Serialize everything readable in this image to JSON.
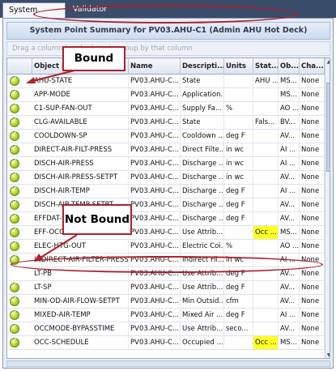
{
  "tabs": [
    {
      "label": "System Summary",
      "active": true
    },
    {
      "label": "Validator",
      "active": false
    }
  ],
  "panel": {
    "title": "System Point Summary for PV03.AHU-C1 (Admin AHU Hot Deck)",
    "group_hint": "Drag a column header here to group by that column"
  },
  "columns": [
    "",
    "Object N",
    "Name",
    "Descripti...",
    "Units",
    "Stat...",
    "Ob...",
    "Cha..."
  ],
  "rows": [
    {
      "object_name": "AHU-STATE",
      "name": "PV03.AHU-C...",
      "description": "State",
      "units": "",
      "status": "AHU ...",
      "object": "MS...",
      "change": "None",
      "status_highlight": false
    },
    {
      "object_name": "APP-MODE",
      "name": "PV03.AHU-C...",
      "description": "Application...",
      "units": "",
      "status": "",
      "object": "MS...",
      "change": "None",
      "status_highlight": false
    },
    {
      "object_name": "C1-SUP-FAN-OUT",
      "name": "PV03.AHU-C...",
      "description": "Supply Fa...",
      "units": "%",
      "status": "",
      "object": "AO ...",
      "change": "None",
      "status_highlight": false
    },
    {
      "object_name": "CLG-AVAILABLE",
      "name": "PV03.AHU-C...",
      "description": "State",
      "units": "",
      "status": "Fals...",
      "object": "BV...",
      "change": "None",
      "status_highlight": false
    },
    {
      "object_name": "COOLDOWN-SP",
      "name": "PV03.AHU-C...",
      "description": "Cooldown ...",
      "units": "deg F",
      "status": "",
      "object": "AV...",
      "change": "None",
      "status_highlight": false
    },
    {
      "object_name": "DIRECT-AIR-FILT-PRESS",
      "name": "PV03.AHU-C...",
      "description": "Direct Filte...",
      "units": "in wc",
      "status": "",
      "object": "AI ...",
      "change": "None",
      "status_highlight": false
    },
    {
      "object_name": "DISCH-AIR-PRESS",
      "name": "PV03.AHU-C...",
      "description": "Discharge ...",
      "units": "in wc",
      "status": "",
      "object": "AI ...",
      "change": "None",
      "status_highlight": false
    },
    {
      "object_name": "DISCH-AIR-PRESS-SETPT",
      "name": "PV03.AHU-C...",
      "description": "Discharge ...",
      "units": "in wc",
      "status": "",
      "object": "AV...",
      "change": "None",
      "status_highlight": false
    },
    {
      "object_name": "DISCH-AIR-TEMP",
      "name": "PV03.AHU-C...",
      "description": "Discharge ...",
      "units": "deg F",
      "status": "",
      "object": "AI ...",
      "change": "None",
      "status_highlight": false
    },
    {
      "object_name": "DISCH-AIR-TEMP-SETPT",
      "name": "PV03.AHU-C...",
      "description": "Discharge ...",
      "units": "deg F",
      "status": "",
      "object": "AV...",
      "change": "None",
      "status_highlight": false
    },
    {
      "object_name": "EFFDAT-SP",
      "name": "PV03.AHU-C...",
      "description": "Discharge ...",
      "units": "deg F",
      "status": "",
      "object": "AV...",
      "change": "None",
      "status_highlight": false
    },
    {
      "object_name": "EFF-OCC",
      "name": "PV03.AHU-C...",
      "description": "Use Attrib...",
      "units": "",
      "status": "Occ ...",
      "object": "MS...",
      "change": "None",
      "status_highlight": true
    },
    {
      "object_name": "ELEC-HTG-OUT",
      "name": "PV03.AHU-C...",
      "description": "Electric Coi...",
      "units": "%",
      "status": "",
      "object": "AO ...",
      "change": "None",
      "status_highlight": false
    },
    {
      "object_name": "INDIRECT-AIR-FILTER-PRESS",
      "name": "PV03.AHU-C...",
      "description": "Indirect Fil...",
      "units": "in wc",
      "status": "",
      "object": "AI ...",
      "change": "None",
      "status_highlight": false
    },
    {
      "object_name": "LT-PB",
      "name": "PV03.AHU-C...",
      "description": "Use Attrib...",
      "units": "deg F",
      "status": "",
      "object": "AV...",
      "change": "None",
      "status_highlight": false,
      "unbound": true
    },
    {
      "object_name": "LT-SP",
      "name": "PV03.AHU-C...",
      "description": "Use Attrib...",
      "units": "deg F",
      "status": "",
      "object": "AV...",
      "change": "None",
      "status_highlight": false
    },
    {
      "object_name": "MIN-OD-AIR-FLOW-SETPT",
      "name": "PV03.AHU-C...",
      "description": "Min Outsid...",
      "units": "cfm",
      "status": "",
      "object": "AV...",
      "change": "None",
      "status_highlight": false
    },
    {
      "object_name": "MIXED-AIR-TEMP",
      "name": "PV03.AHU-C...",
      "description": "Mixed Air ...",
      "units": "deg F",
      "status": "",
      "object": "AI ...",
      "change": "None",
      "status_highlight": false
    },
    {
      "object_name": "OCCMODE-BYPASSTIME",
      "name": "PV03.AHU-C...",
      "description": "Use Attrib...",
      "units": "seco...",
      "status": "",
      "object": "AV...",
      "change": "None",
      "status_highlight": false
    },
    {
      "object_name": "OCC-SCHEDULE",
      "name": "PV03.AHU-C...",
      "description": "Occupied ...",
      "units": "",
      "status": "Occ ...",
      "object": "MS...",
      "change": "None",
      "status_highlight": true
    }
  ],
  "annotations": {
    "bound_label": "Bound",
    "not_bound_label": "Not Bound",
    "color": "#b0202a"
  },
  "colors": {
    "tabbar": "#3a4d6b",
    "highlight": "#ffff22",
    "indicator": "#9acb18"
  },
  "icons": {
    "indicator": "green-check-circle-icon"
  }
}
